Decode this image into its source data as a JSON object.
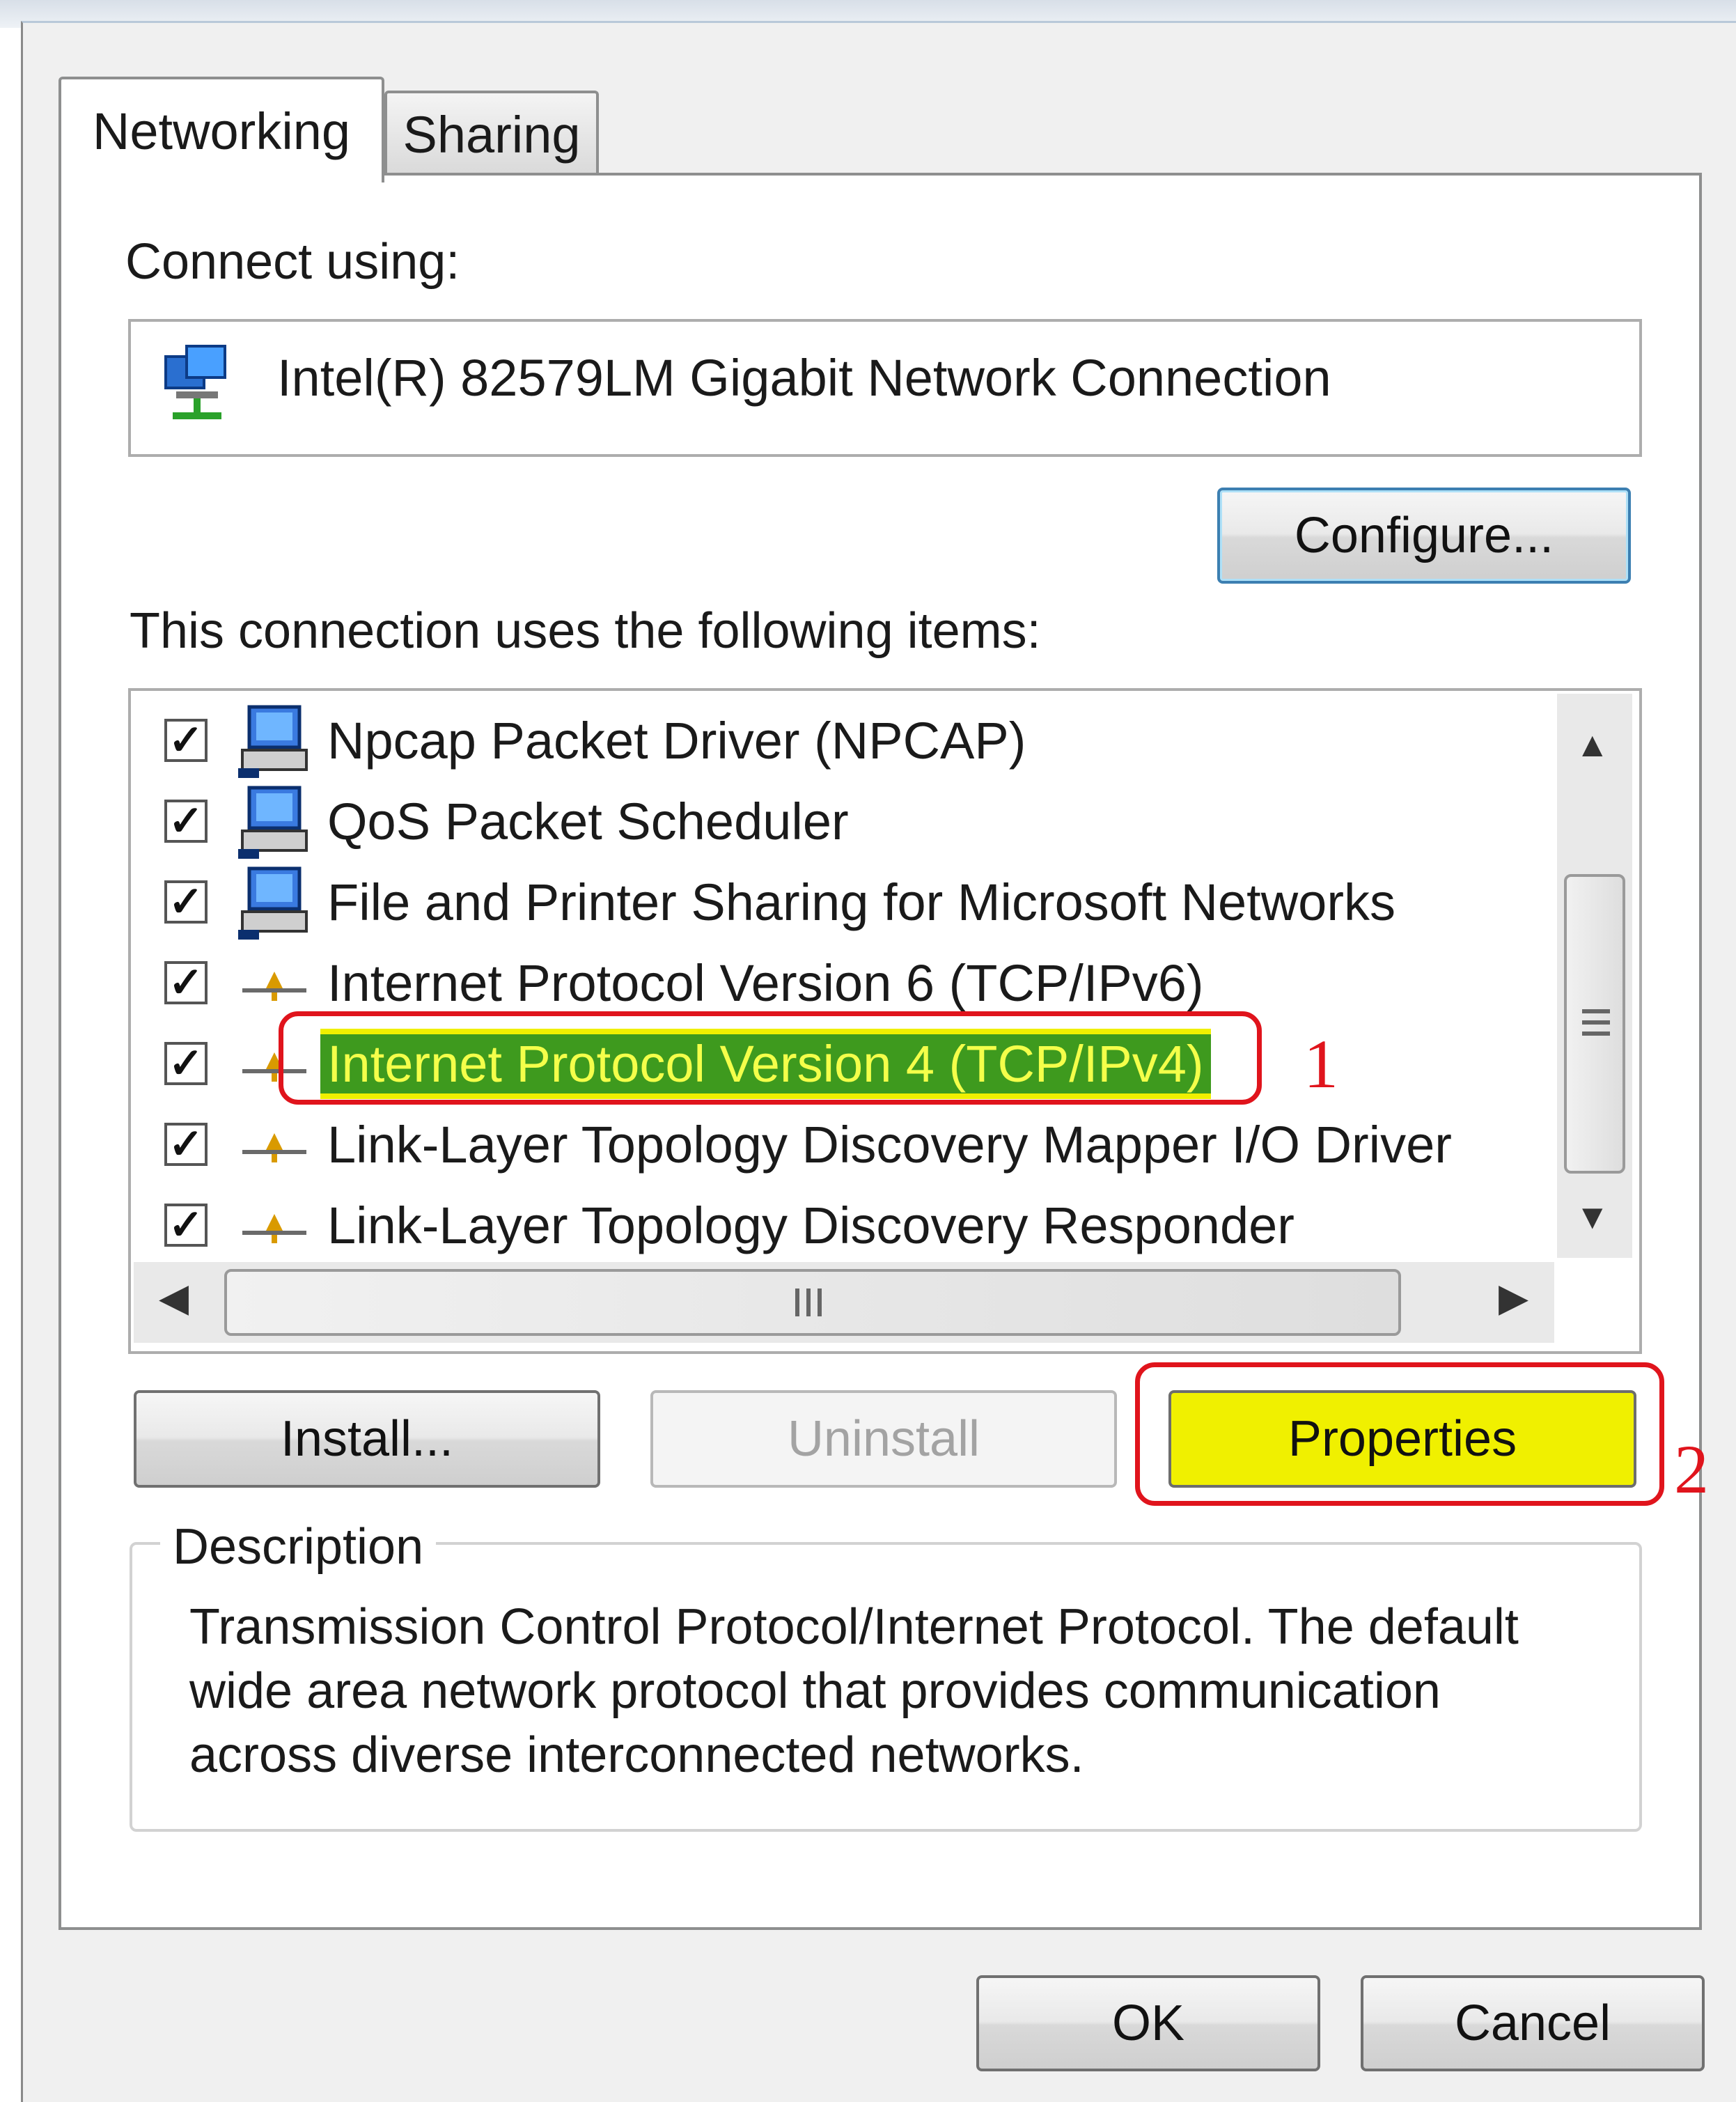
{
  "tabs": [
    {
      "label": "Networking"
    },
    {
      "label": "Sharing"
    }
  ],
  "connect_using": {
    "label": "Connect using:",
    "adapter_name": "Intel(R) 82579LM Gigabit Network Connection",
    "configure_label": "Configure..."
  },
  "items_section": {
    "label": "This connection uses the following items:",
    "items": [
      {
        "label": "Npcap Packet Driver (NPCAP)",
        "checked": true,
        "icon": "computer-icon"
      },
      {
        "label": "QoS Packet Scheduler",
        "checked": true,
        "icon": "computer-icon"
      },
      {
        "label": "File and Printer Sharing for Microsoft Networks",
        "checked": true,
        "icon": "computer-icon"
      },
      {
        "label": "Internet Protocol Version 6 (TCP/IPv6)",
        "checked": true,
        "icon": "protocol-icon"
      },
      {
        "label": "Internet Protocol Version 4 (TCP/IPv4)",
        "checked": true,
        "icon": "protocol-icon",
        "selected": true
      },
      {
        "label": "Link-Layer Topology Discovery Mapper I/O Driver",
        "checked": true,
        "icon": "protocol-icon"
      },
      {
        "label": "Link-Layer Topology Discovery Responder",
        "checked": true,
        "icon": "protocol-icon"
      }
    ]
  },
  "buttons": {
    "install": "Install...",
    "uninstall": "Uninstall",
    "properties": "Properties",
    "ok": "OK",
    "cancel": "Cancel"
  },
  "description": {
    "title": "Description",
    "lines": [
      "Transmission Control Protocol/Internet Protocol. The default",
      "wide area network protocol that provides communication",
      "across diverse interconnected networks."
    ]
  },
  "annotations": {
    "step1": "1",
    "step2": "2",
    "color": "#e0141c"
  },
  "checkmark": "✓"
}
